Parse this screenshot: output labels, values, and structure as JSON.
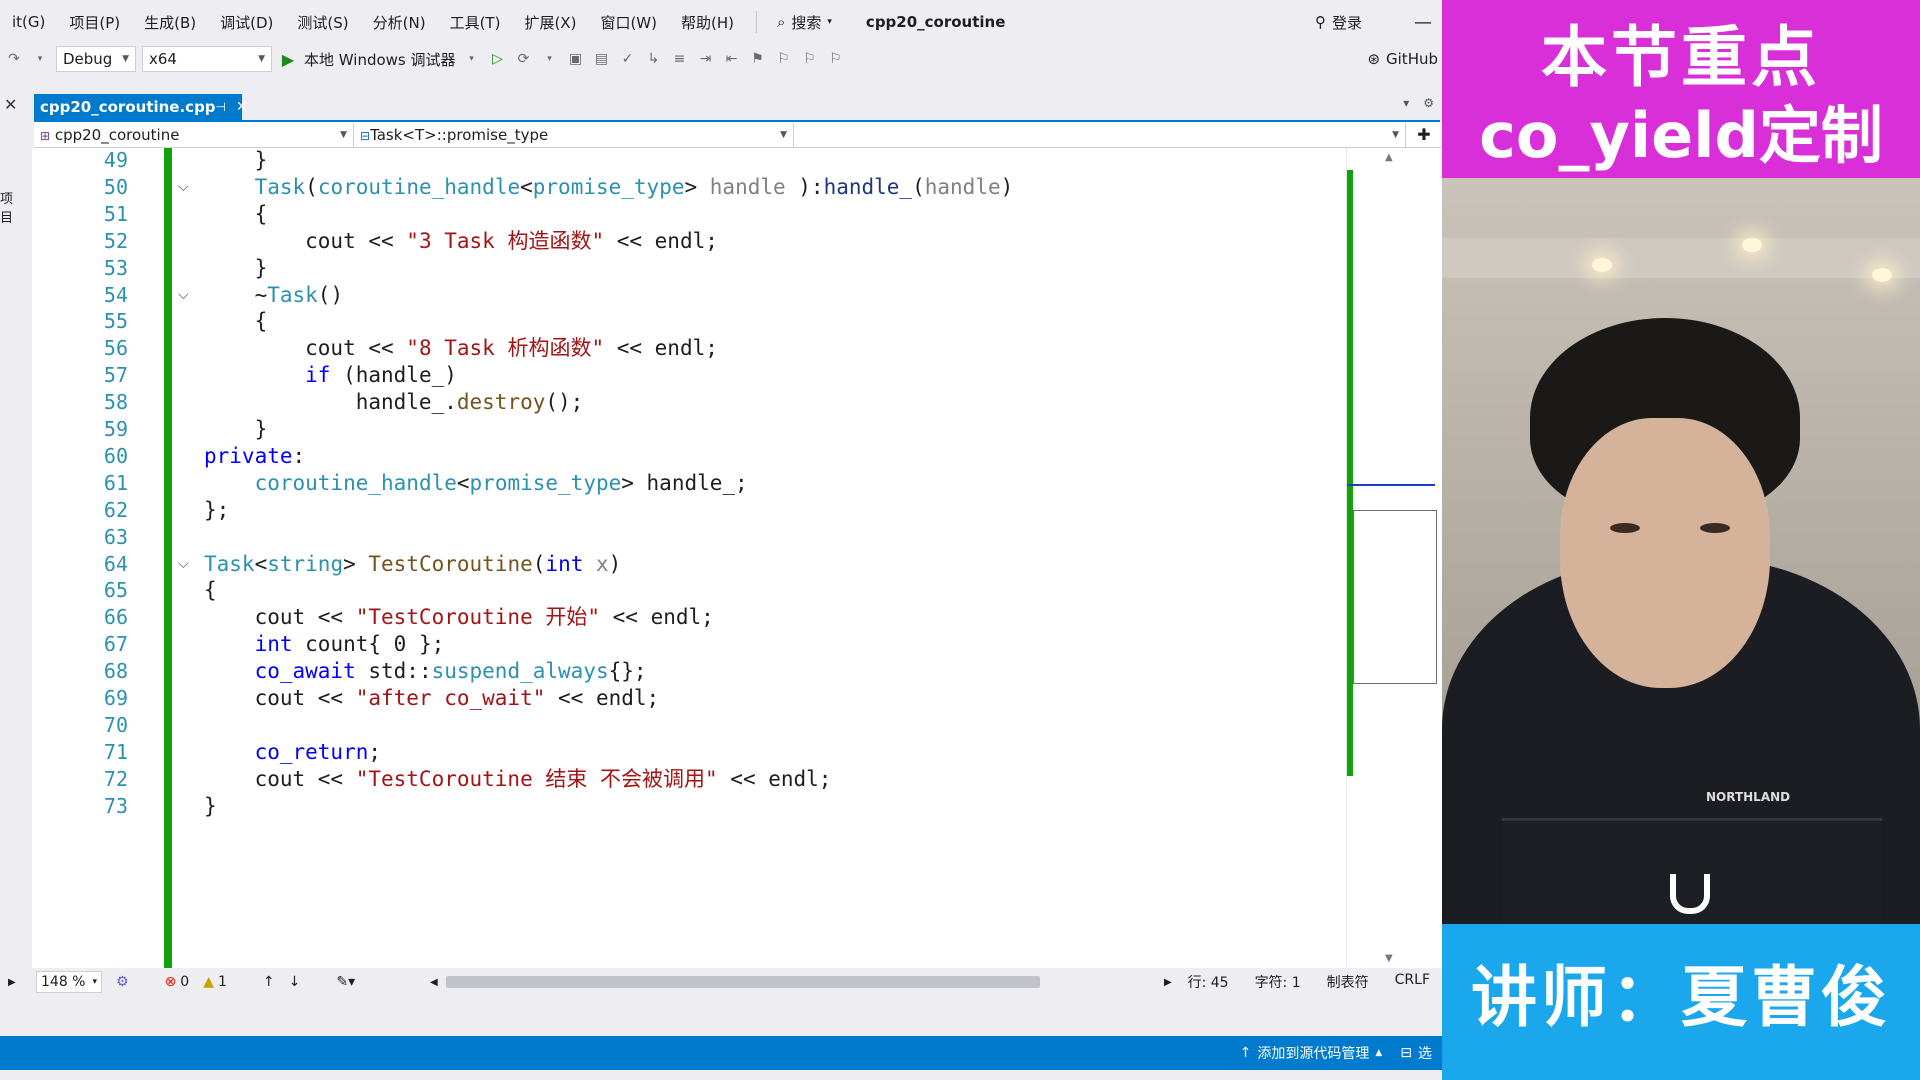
{
  "menu": {
    "items": [
      "it(G)",
      "项目(P)",
      "生成(B)",
      "调试(D)",
      "测试(S)",
      "分析(N)",
      "工具(T)",
      "扩展(X)",
      "窗口(W)",
      "帮助(H)"
    ],
    "search_label": "搜索",
    "project_title": "cpp20_coroutine",
    "login_label": "登录",
    "minimize": "—"
  },
  "toolbar": {
    "config": "Debug",
    "platform": "x64",
    "run_label": "本地 Windows 调试器",
    "github_label": "GitHub"
  },
  "tab": {
    "filename": "cpp20_coroutine.cpp",
    "pin": "⊣",
    "close": "✕"
  },
  "navbar": {
    "scope": "cpp20_coroutine",
    "member": "Task<T>::promise_type",
    "third": ""
  },
  "left_strip": {
    "label": "项目"
  },
  "code": {
    "lines": [
      {
        "n": "49",
        "html": "    }"
      },
      {
        "n": "50",
        "html": "    <span class='ty'>Task</span>(<span class='ty'>coroutine_handle</span>&lt;<span class='ty'>promise_type</span>&gt; <span class='pa'>handle</span> ):<span class='mb'>handle_</span>(<span class='pa'>handle</span>)"
      },
      {
        "n": "51",
        "html": "    {"
      },
      {
        "n": "52",
        "html": "        cout &lt;&lt; <span class='st'>\"3 Task 构造函数\"</span> &lt;&lt; endl;"
      },
      {
        "n": "53",
        "html": "    }"
      },
      {
        "n": "54",
        "html": "    ~<span class='ty'>Task</span>()"
      },
      {
        "n": "55",
        "html": "    {"
      },
      {
        "n": "56",
        "html": "        cout &lt;&lt; <span class='st'>\"8 Task 析构函数\"</span> &lt;&lt; endl;"
      },
      {
        "n": "57",
        "html": "        <span class='kw'>if</span> (handle_)"
      },
      {
        "n": "58",
        "html": "            handle_.<span class='fn'>destroy</span>();"
      },
      {
        "n": "59",
        "html": "    }"
      },
      {
        "n": "60",
        "html": "<span class='kw'>private</span>:"
      },
      {
        "n": "61",
        "html": "    <span class='ty'>coroutine_handle</span>&lt;<span class='ty'>promise_type</span>&gt; handle_;"
      },
      {
        "n": "62",
        "html": "};"
      },
      {
        "n": "63",
        "html": ""
      },
      {
        "n": "64",
        "html": "<span class='ty'>Task</span>&lt;<span class='ty'>string</span>&gt; <span class='fn'>TestCoroutine</span>(<span class='kw'>int</span> <span class='pa'>x</span>)"
      },
      {
        "n": "65",
        "html": "{"
      },
      {
        "n": "66",
        "html": "    cout &lt;&lt; <span class='st'>\"TestCoroutine 开始\"</span> &lt;&lt; endl;"
      },
      {
        "n": "67",
        "html": "    <span class='kw'>int</span> count{ 0 };"
      },
      {
        "n": "68",
        "html": "    <span class='kw'>co_await</span> std::<span class='ty'>suspend_always</span>{};"
      },
      {
        "n": "69",
        "html": "    cout &lt;&lt; <span class='st'>\"after co_wait\"</span> &lt;&lt; endl;"
      },
      {
        "n": "70",
        "html": ""
      },
      {
        "n": "71",
        "html": "    <span class='kw'>co_return</span>;"
      },
      {
        "n": "72",
        "html": "    cout &lt;&lt; <span class='st'>\"TestCoroutine 结束 不会被调用\"</span> &lt;&lt; endl;"
      },
      {
        "n": "73",
        "html": "}"
      }
    ],
    "fold_lines": [
      "50",
      "54",
      "64"
    ]
  },
  "status": {
    "zoom": "148 %",
    "errors": "0",
    "warnings": "1",
    "line": "行: 45",
    "char": "字符: 1",
    "tabs": "制表符",
    "eol": "CRLF"
  },
  "statusbar": {
    "source_control": "添加到源代码管理",
    "select": "选"
  },
  "overlay": {
    "banner_line1": "本节重点",
    "banner_line2": "co_yield定制",
    "lecturer": "讲师：夏曹俊",
    "shirt_brand": "NORTHLAND"
  },
  "colors": {
    "accent": "#007acc",
    "banner": "#d82fd8",
    "lecturer_bg": "#1aa7ec",
    "change_bar": "#13a10e"
  }
}
